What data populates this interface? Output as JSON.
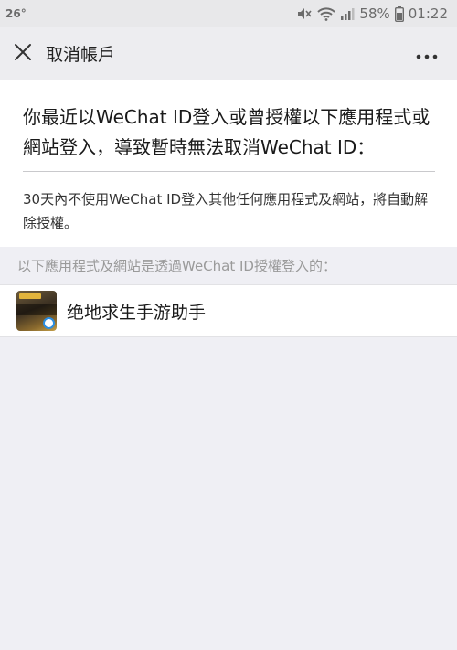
{
  "status_bar": {
    "temperature": "26°",
    "battery": "58%",
    "time": "01:22"
  },
  "nav": {
    "title": "取消帳戶"
  },
  "card": {
    "heading": "你最近以WeChat ID登入或曾授權以下應用程式或網站登入，導致暫時無法取消WeChat ID：",
    "note": "30天內不使用WeChat ID登入其他任何應用程式及網站，將自動解除授權。"
  },
  "section_label": "以下應用程式及網站是透過WeChat ID授權登入的：",
  "apps": [
    {
      "name": "绝地求生手游助手"
    }
  ],
  "icons": [
    "close-icon",
    "more-icon",
    "mute-icon",
    "wifi-icon",
    "signal-icon",
    "battery-icon",
    "app-icon"
  ]
}
